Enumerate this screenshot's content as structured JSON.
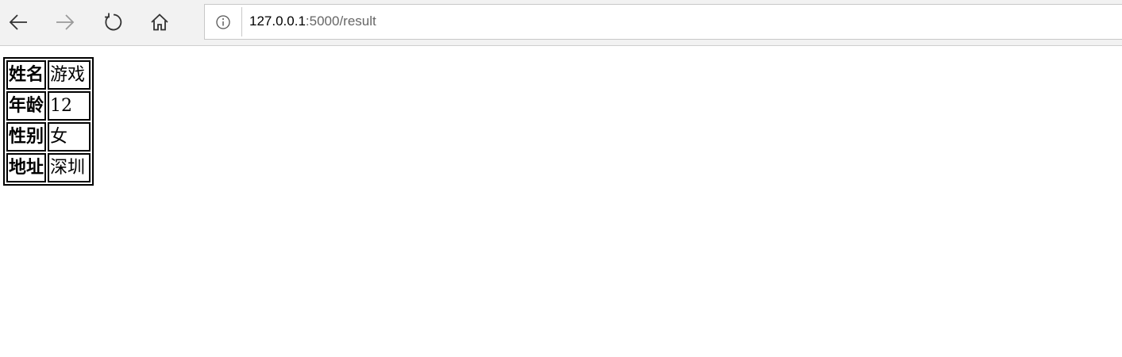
{
  "browser": {
    "url_host": "127.0.0.1",
    "url_rest": ":5000/result",
    "icons": {
      "back": "back-arrow-icon",
      "forward": "forward-arrow-icon",
      "refresh": "refresh-icon",
      "home": "home-icon",
      "site_info": "info-icon"
    },
    "forward_enabled": false
  },
  "table": {
    "rows": [
      {
        "label": "姓名",
        "value": "游戏"
      },
      {
        "label": "年龄",
        "value": "12"
      },
      {
        "label": "性别",
        "value": "女"
      },
      {
        "label": "地址",
        "value": "深圳"
      }
    ]
  },
  "colors": {
    "toolbar_bg": "#f2f2f2",
    "url_host": "#000000",
    "url_path": "#666666",
    "forward_disabled": "#9a9a9a"
  }
}
